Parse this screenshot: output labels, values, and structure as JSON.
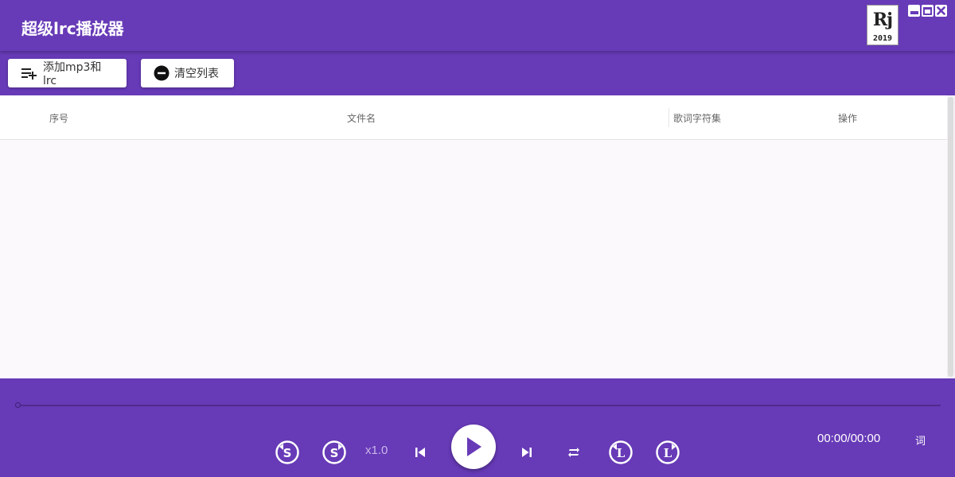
{
  "window": {
    "title": "超级lrc播放器",
    "logo": {
      "mark": "Rj",
      "year": "2019"
    },
    "controls": [
      "minimize",
      "maximize",
      "close"
    ]
  },
  "toolbar": {
    "add_label": "添加mp3和lrc",
    "add_icon": "playlist-add-icon",
    "clear_label": "清空列表",
    "clear_icon": "remove-circle-icon"
  },
  "table": {
    "columns": [
      "序号",
      "文件名",
      "歌词字符集",
      "操作"
    ],
    "rows": []
  },
  "player": {
    "progress": 0,
    "speed": "x1.0",
    "time": "00:00/00:00",
    "lyric_label": "词",
    "buttons": [
      "rewind-s-icon",
      "forward-s-icon",
      "previous-icon",
      "play-icon",
      "next-icon",
      "repeat-icon",
      "lyric-back-icon",
      "lyric-forward-icon"
    ]
  },
  "colors": {
    "primary": "#673ab7",
    "table_bg": "#fbf9fc",
    "speed_text": "#c9b6ea"
  }
}
